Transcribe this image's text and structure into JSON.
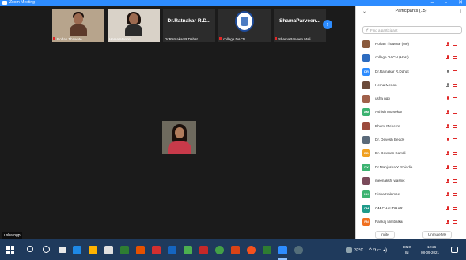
{
  "window": {
    "title": "Zoom Meeting"
  },
  "video_strip": {
    "tiles": [
      {
        "name": "Rohan Thawate",
        "kind": "photo",
        "muted": true
      },
      {
        "name": "Hema Menon",
        "kind": "photo",
        "muted": false
      },
      {
        "name": "Dr.Ratnakar R.Dahat",
        "big_name": "Dr.Ratnakar R.D...",
        "kind": "name",
        "muted": false
      },
      {
        "name": "college DACN",
        "kind": "logo",
        "muted": true
      },
      {
        "name": "ShamaParveen Mali",
        "big_name": "ShamaParveen...",
        "kind": "name",
        "muted": true
      }
    ],
    "next_label": "›"
  },
  "active_speaker": {
    "name": "usha ngp"
  },
  "participants": {
    "title": "Participants (15)",
    "search_placeholder": "Find a participant",
    "list": [
      {
        "name": "Rohan Thawate (Me)",
        "initials": "",
        "color": "#8a5a3c",
        "mic": "muted"
      },
      {
        "name": "college DACN (Host)",
        "initials": "",
        "color": "#2d6cc0",
        "mic": "muted"
      },
      {
        "name": "Dr.Ratnakar R.Dahat",
        "initials": "DR",
        "color": "#2d8cff",
        "mic": "unmuted"
      },
      {
        "name": "Hema Menon",
        "initials": "",
        "color": "#6b4a3a",
        "mic": "unmuted"
      },
      {
        "name": "usha ngp",
        "initials": "",
        "color": "#a0604a",
        "mic": "muted"
      },
      {
        "name": "Ashish Morsekar",
        "initials": "AM",
        "color": "#3cb371",
        "mic": "muted"
      },
      {
        "name": "Bhumi Meherre",
        "initials": "",
        "color": "#9b4a3c",
        "mic": "muted"
      },
      {
        "name": "Dr. Devesh Begde",
        "initials": "",
        "color": "#5a6a7a",
        "mic": "muted"
      },
      {
        "name": "Dr. Devman Kamdi",
        "initials": "DD",
        "color": "#f0a020",
        "mic": "muted"
      },
      {
        "name": "Dr.Manjusha Y. Shiddie",
        "initials": "DY",
        "color": "#3cb371",
        "mic": "muted"
      },
      {
        "name": "meenakshi wasnik",
        "initials": "",
        "color": "#7a4a5a",
        "mic": "muted"
      },
      {
        "name": "Nisha Kalambe",
        "initials": "NK",
        "color": "#3cb371",
        "mic": "muted"
      },
      {
        "name": "OM CHAUDHARI",
        "initials": "OM",
        "color": "#1e9a8a",
        "mic": "muted"
      },
      {
        "name": "Pankaj Nimbalkar",
        "initials": "PN",
        "color": "#f07020",
        "mic": "muted"
      }
    ],
    "invite_label": "Invite",
    "mute_all_label": "Unmute Me"
  },
  "taskbar": {
    "weather": "32°C",
    "language": "ENG",
    "region": "IN",
    "time": "12:26",
    "date": "08-09-2021"
  },
  "colors": {
    "accent": "#2d8cff",
    "muted": "#e02828",
    "taskbar": "#1f3a5c"
  }
}
